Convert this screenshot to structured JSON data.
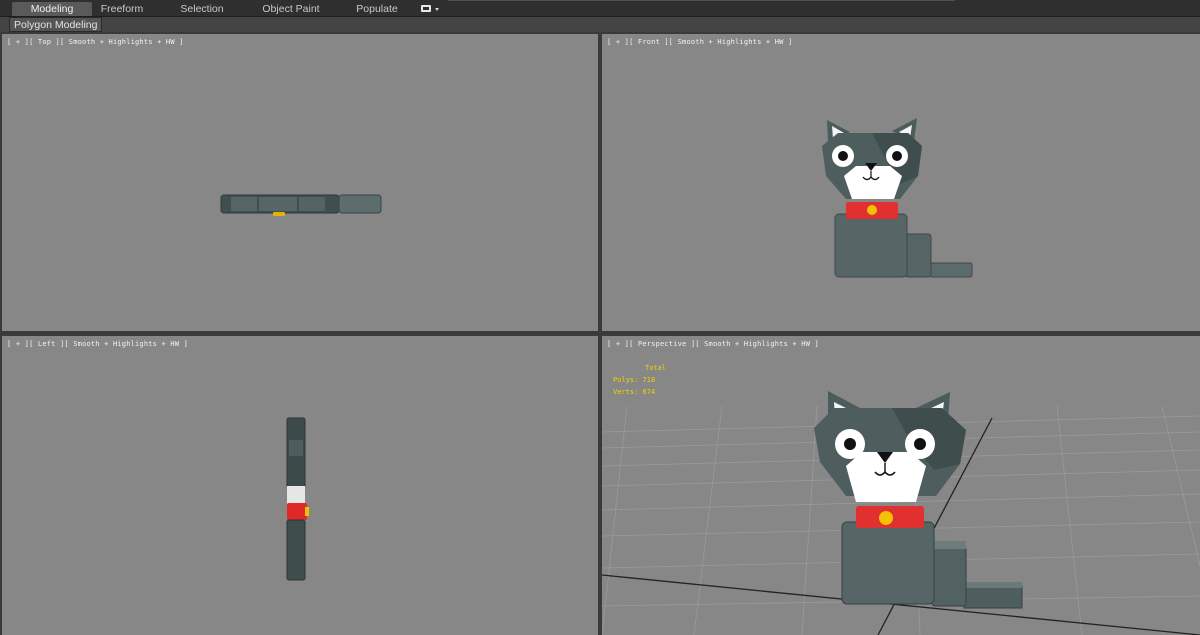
{
  "ribbon": {
    "tabs": [
      {
        "label": "Modeling",
        "active": true
      },
      {
        "label": "Freeform",
        "active": false
      },
      {
        "label": "Selection",
        "active": false
      },
      {
        "label": "Object Paint",
        "active": false
      },
      {
        "label": "Populate",
        "active": false
      }
    ],
    "expander_icon": "ribbon-display-options-icon"
  },
  "panel": {
    "label": "Polygon Modeling"
  },
  "viewports": {
    "top": {
      "label": "[ + ][ Top ][ Smooth + Highlights + HW ]"
    },
    "front": {
      "label": "[ + ][ Front ][ Smooth + Highlights + HW ]"
    },
    "left": {
      "label": "[ + ][ Left ][ Smooth + Highlights + HW ]"
    },
    "perspective": {
      "label": "[ + ][ Perspective ][ Smooth + Highlights + HW ]"
    }
  },
  "stats": {
    "header": "Total",
    "polys_label": "Polys:",
    "polys_value": "718",
    "verts_label": "Verts:",
    "verts_value": "674"
  },
  "colors": {
    "viewport_bg": "#878787",
    "cat_body": "#4f5f5f",
    "cat_face": "#ffffff",
    "collar": "#e23030",
    "bell": "#f2c200",
    "stats_text": "#f1d200"
  }
}
